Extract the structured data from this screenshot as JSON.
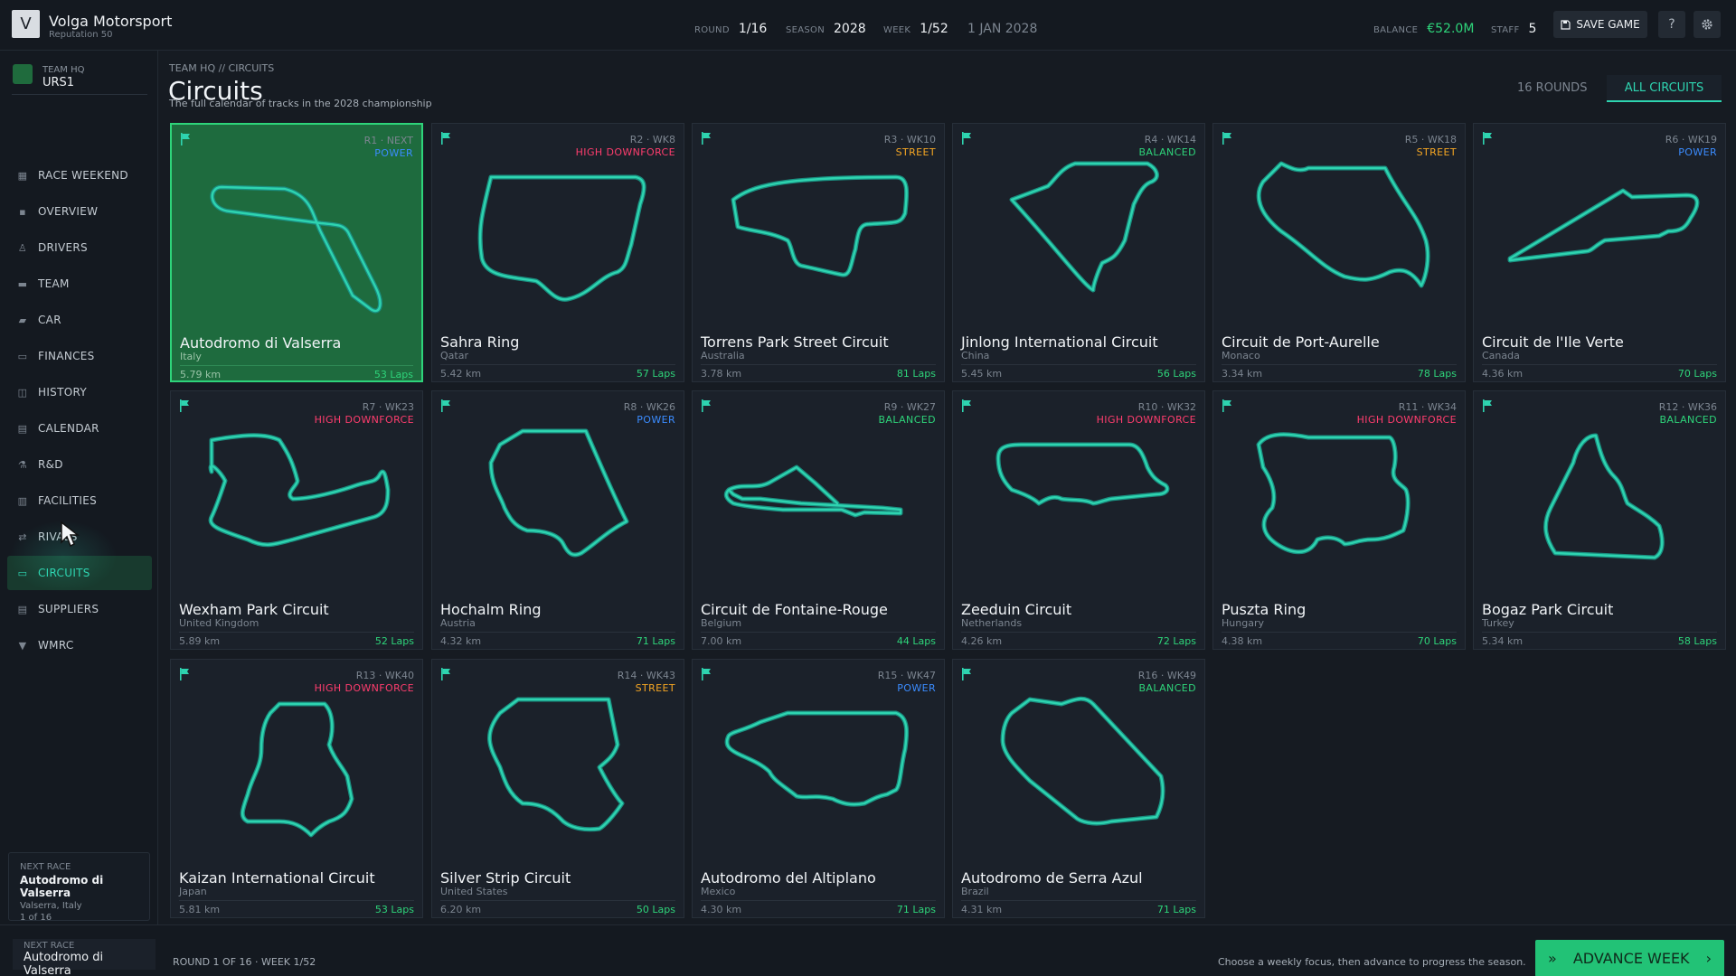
{
  "header": {
    "logo_letter": "V",
    "team_name": "Volga Motorsport",
    "reputation": "Reputation 50",
    "stats": [
      {
        "key": "ROUND",
        "value": "1/16"
      },
      {
        "key": "SEASON",
        "value": "2028"
      },
      {
        "key": "WEEK",
        "value": "1/52"
      },
      {
        "key": "",
        "value": "1 JAN 2028"
      },
      {
        "key": "BALANCE",
        "value": "€52.0M"
      },
      {
        "key": "STAFF",
        "value": "5"
      }
    ],
    "save_label": "SAVE GAME",
    "help_label": "?",
    "settings_icon": "gear-icon"
  },
  "sidebar": {
    "hq_label": "TEAM HQ",
    "hq_code": "URS1",
    "items": [
      {
        "label": "RACE WEEKEND",
        "icon": "calendar-flag-icon"
      },
      {
        "label": "OVERVIEW",
        "icon": "grid-icon"
      },
      {
        "label": "DRIVERS",
        "icon": "driver-icon"
      },
      {
        "label": "TEAM",
        "icon": "team-icon"
      },
      {
        "label": "CAR",
        "icon": "car-icon"
      },
      {
        "label": "FINANCES",
        "icon": "card-icon"
      },
      {
        "label": "HISTORY",
        "icon": "history-icon"
      },
      {
        "label": "CALENDAR",
        "icon": "calendar-icon"
      },
      {
        "label": "R&D",
        "icon": "flask-icon"
      },
      {
        "label": "FACILITIES",
        "icon": "factory-icon"
      },
      {
        "label": "RIVALS",
        "icon": "rivals-icon"
      },
      {
        "label": "CIRCUITS",
        "icon": "circuit-icon",
        "active": true
      },
      {
        "label": "SUPPLIERS",
        "icon": "supplier-icon"
      },
      {
        "label": "WMRC",
        "icon": "trophy-icon"
      }
    ],
    "next_race": {
      "label": "NEXT RACE",
      "name": "Autodromo di Valserra",
      "location": "Valserra, Italy",
      "progress": "1 of 16"
    }
  },
  "main": {
    "breadcrumb": "TEAM HQ // CIRCUITS",
    "title": "Circuits",
    "subtitle": "The full calendar of tracks in the 2028 championship",
    "rounds_count": "16 ROUNDS",
    "filter_label": "ALL CIRCUITS",
    "circuits": [
      {
        "round": "R1 · NEXT",
        "type": "POWER",
        "type_class": "power",
        "name": "Autodromo di Valserra",
        "country": "Italy",
        "length": "5.79 km",
        "laps": "53 Laps",
        "selected": true
      },
      {
        "round": "R2 · WK8",
        "type": "HIGH DOWNFORCE",
        "type_class": "high-downforce",
        "name": "Sahra Ring",
        "country": "Qatar",
        "length": "5.42 km",
        "laps": "57 Laps"
      },
      {
        "round": "R3 · WK10",
        "type": "STREET",
        "type_class": "street",
        "name": "Torrens Park Street Circuit",
        "country": "Australia",
        "length": "3.78 km",
        "laps": "81 Laps"
      },
      {
        "round": "R4 · WK14",
        "type": "BALANCED",
        "type_class": "balanced",
        "name": "Jinlong International Circuit",
        "country": "China",
        "length": "5.45 km",
        "laps": "56 Laps"
      },
      {
        "round": "R5 · WK18",
        "type": "STREET",
        "type_class": "street",
        "name": "Circuit de Port-Aurelle",
        "country": "Monaco",
        "length": "3.34 km",
        "laps": "78 Laps"
      },
      {
        "round": "R6 · WK19",
        "type": "POWER",
        "type_class": "power",
        "name": "Circuit de l'Ile Verte",
        "country": "Canada",
        "length": "4.36 km",
        "laps": "70 Laps"
      },
      {
        "round": "R7 · WK23",
        "type": "HIGH DOWNFORCE",
        "type_class": "high-downforce",
        "name": "Wexham Park Circuit",
        "country": "United Kingdom",
        "length": "5.89 km",
        "laps": "52 Laps"
      },
      {
        "round": "R8 · WK26",
        "type": "POWER",
        "type_class": "power",
        "name": "Hochalm Ring",
        "country": "Austria",
        "length": "4.32 km",
        "laps": "71 Laps"
      },
      {
        "round": "R9 · WK27",
        "type": "BALANCED",
        "type_class": "balanced",
        "name": "Circuit de Fontaine-Rouge",
        "country": "Belgium",
        "length": "7.00 km",
        "laps": "44 Laps"
      },
      {
        "round": "R10 · WK32",
        "type": "HIGH DOWNFORCE",
        "type_class": "high-downforce",
        "name": "Zeeduin Circuit",
        "country": "Netherlands",
        "length": "4.26 km",
        "laps": "72 Laps"
      },
      {
        "round": "R11 · WK34",
        "type": "HIGH DOWNFORCE",
        "type_class": "high-downforce",
        "name": "Puszta Ring",
        "country": "Hungary",
        "length": "4.38 km",
        "laps": "70 Laps"
      },
      {
        "round": "R12 · WK36",
        "type": "BALANCED",
        "type_class": "balanced",
        "name": "Bogaz Park Circuit",
        "country": "Turkey",
        "length": "5.34 km",
        "laps": "58 Laps"
      },
      {
        "round": "R13 · WK40",
        "type": "HIGH DOWNFORCE",
        "type_class": "high-downforce",
        "name": "Kaizan International Circuit",
        "country": "Japan",
        "length": "5.81 km",
        "laps": "53 Laps"
      },
      {
        "round": "R14 · WK43",
        "type": "STREET",
        "type_class": "street",
        "name": "Silver Strip Circuit",
        "country": "United States",
        "length": "6.20 km",
        "laps": "50 Laps"
      },
      {
        "round": "R15 · WK47",
        "type": "POWER",
        "type_class": "power",
        "name": "Autodromo del Altiplano",
        "country": "Mexico",
        "length": "4.30 km",
        "laps": "71 Laps"
      },
      {
        "round": "R16 · WK49",
        "type": "BALANCED",
        "type_class": "balanced",
        "name": "Autodromo de Serra Azul",
        "country": "Brazil",
        "length": "4.31 km",
        "laps": "71 Laps"
      }
    ]
  },
  "footer": {
    "next_label": "NEXT RACE",
    "next_name": "Autodromo di Valserra",
    "round_info": "ROUND 1 OF 16  ·  WEEK 1/52",
    "hint": "Choose a weekly focus, then advance to progress the season.",
    "advance_label": "ADVANCE WEEK"
  },
  "colors": {
    "accent": "#2ed4b0",
    "positive": "#2ed47a",
    "power": "#3b8cff",
    "high_downforce": "#ff3d6e",
    "street": "#f5a623",
    "balanced": "#2ed47a"
  }
}
